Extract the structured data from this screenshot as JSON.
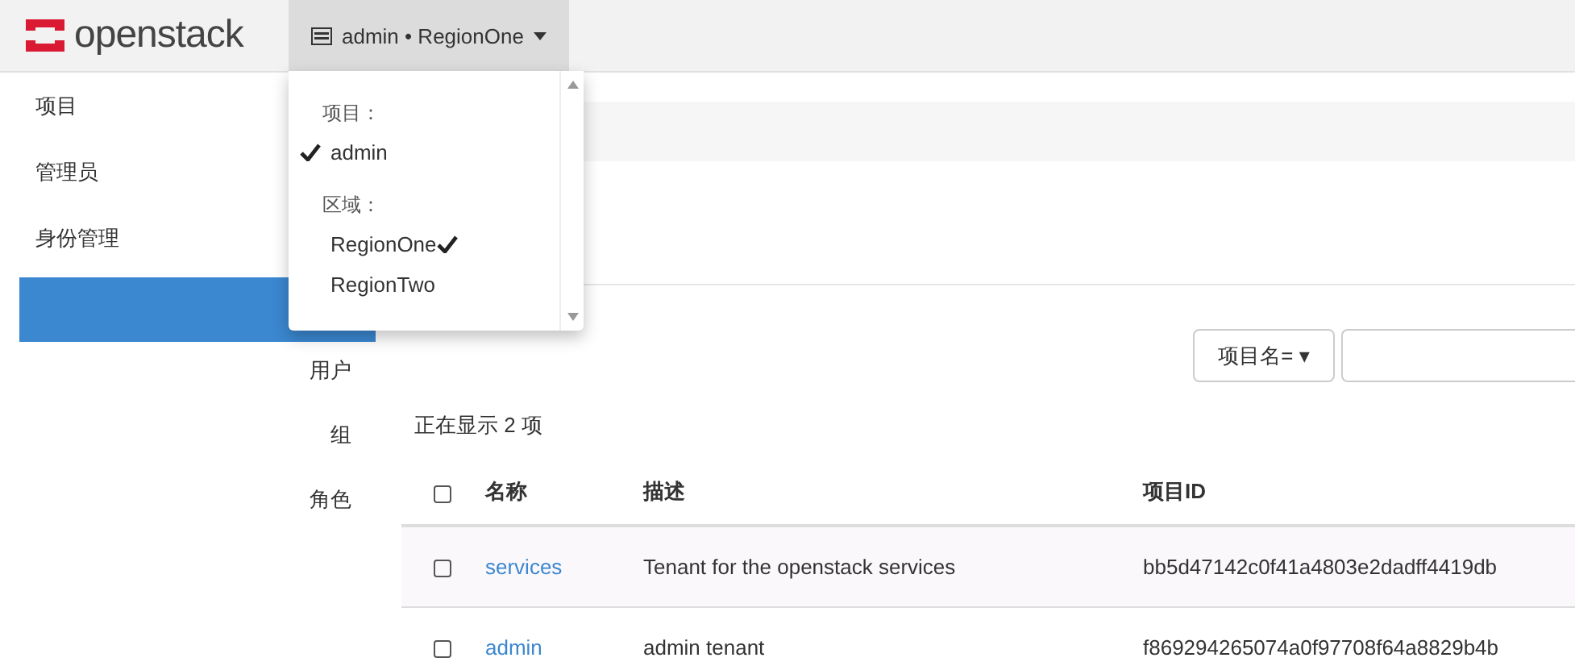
{
  "header": {
    "logo": "openstack",
    "context": "admin • RegionOne"
  },
  "sidebar": {
    "items": [
      {
        "label": "项目"
      },
      {
        "label": "管理员"
      },
      {
        "label": "身份管理"
      }
    ],
    "sub_items": [
      {
        "label": "用户"
      },
      {
        "label": "组"
      },
      {
        "label": "角色"
      }
    ]
  },
  "context_menu": {
    "sections": [
      {
        "heading": "项目：",
        "options": [
          {
            "label": "admin",
            "selected": true,
            "kind": "check-left"
          }
        ]
      },
      {
        "heading": "区域：",
        "options": [
          {
            "label": "RegionOne",
            "selected": true,
            "kind": "check-right"
          },
          {
            "label": "RegionTwo",
            "selected": false,
            "kind": "check-right"
          }
        ]
      }
    ]
  },
  "filter": {
    "field_button": "项目名= ▾"
  },
  "count": "正在显示 2 项",
  "table": {
    "columns": [
      "名称",
      "描述",
      "项目ID"
    ],
    "header_checked": false,
    "rows": [
      {
        "checked": false,
        "name": "services",
        "description": "Tenant for the openstack services",
        "id": "bb5d47142c0f41a4803e2dadff4419db"
      },
      {
        "checked": false,
        "name": "admin",
        "description": "admin tenant",
        "id": "f869294265074a0f97708f64a8829b4b"
      }
    ]
  }
}
